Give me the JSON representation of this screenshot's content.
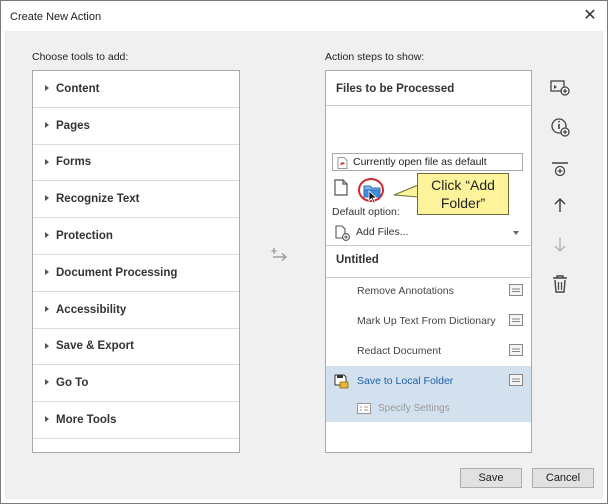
{
  "window": {
    "title": "Create New Action",
    "close_glyph": "✕"
  },
  "tools": {
    "heading": "Choose tools to add:",
    "items": [
      {
        "label": "Content"
      },
      {
        "label": "Pages"
      },
      {
        "label": "Forms"
      },
      {
        "label": "Recognize Text"
      },
      {
        "label": "Protection"
      },
      {
        "label": "Document Processing"
      },
      {
        "label": "Accessibility"
      },
      {
        "label": "Save & Export"
      },
      {
        "label": "Go To"
      },
      {
        "label": "More Tools"
      }
    ]
  },
  "steps": {
    "heading": "Action steps to show:",
    "files_section": "Files to be Processed",
    "current_file_option": "Currently open file as default",
    "default_option_label": "Default option:",
    "add_files_label": "Add Files...",
    "group_title": "Untitled",
    "items": [
      {
        "label": "Remove Annotations"
      },
      {
        "label": "Mark Up Text From Dictionary"
      },
      {
        "label": "Redact Document"
      },
      {
        "label": "Save to Local Folder"
      }
    ],
    "sub_item": "Specify Settings"
  },
  "callout": {
    "line1": "Click “Add",
    "line2": "Folder”"
  },
  "buttons": {
    "save": "Save",
    "cancel": "Cancel"
  },
  "colors": {
    "selected_row": "#d3e1ee",
    "callout_bg": "#fdf39a",
    "highlight_circle": "#d0262b",
    "folder_blue": "#3c8ed8"
  }
}
